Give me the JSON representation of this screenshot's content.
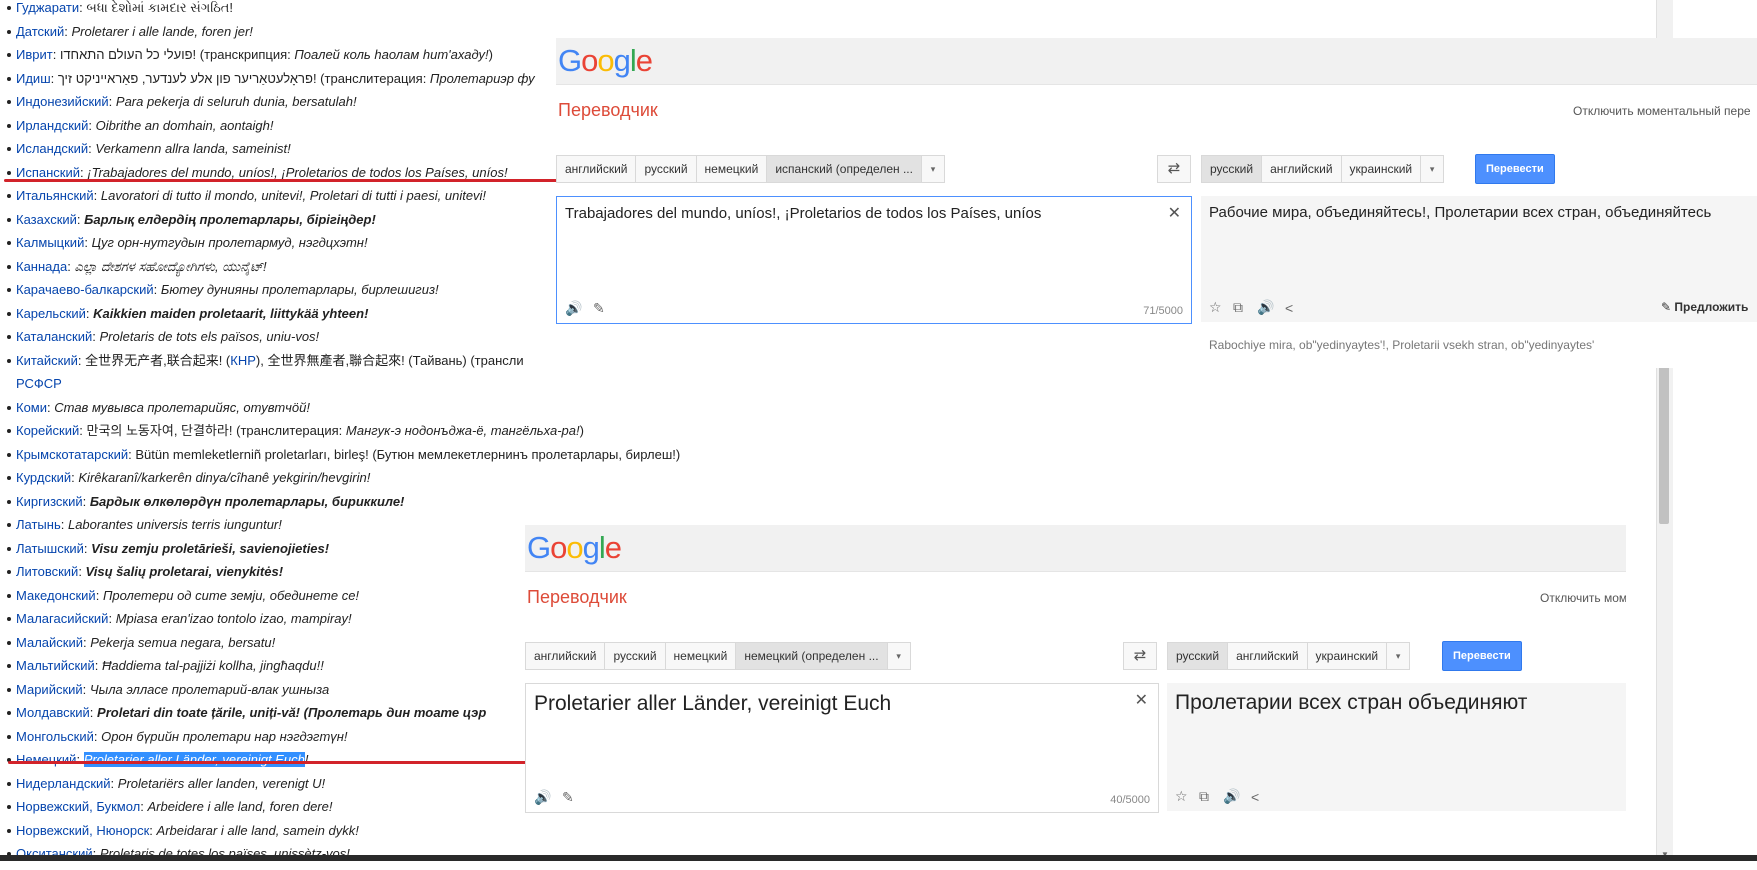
{
  "wiki_list": [
    {
      "lang": "Гуджарати",
      "sep": ": ",
      "phrase": "બધા દેશોમાં કામદાર સંગઠિત!",
      "style": "plain"
    },
    {
      "lang": "Датский",
      "sep": ": ",
      "phrase": "Proletarer i alle lande, foren jer!",
      "style": "italic"
    },
    {
      "lang": "Иврит",
      "sep": ": ",
      "phrase": "פועלי כל העולם התאחדו!",
      "style": "plain",
      "extra": " (транскрипция: ",
      "extra_it": "Поалей коль haолам hит'ахаду!",
      "extra_end": ")"
    },
    {
      "lang": "Идиш",
      "sep": ": ",
      "phrase": "פראָלעטאַריער פון אלע לענדער, פאַראייניקט זיך!",
      "style": "plain",
      "extra": " (транслитерация: ",
      "extra_it": "Пролетариэр фу",
      "extra_end": ""
    },
    {
      "lang": "Индонезийский",
      "sep": ": ",
      "phrase": "Para pekerja di seluruh dunia, bersatulah!",
      "style": "italic"
    },
    {
      "lang": "Ирландский",
      "sep": ": ",
      "phrase": "Oibrithe an domhain, aontaigh!",
      "style": "italic"
    },
    {
      "lang": "Исландский",
      "sep": ": ",
      "phrase": "Verkamenn allra landa, sameinist!",
      "style": "italic"
    },
    {
      "lang": "Испанский",
      "sep": ": ",
      "phrase": "¡Trabajadores del mundo, uníos!, ¡Proletarios de todos los Países, uníos!",
      "style": "italic"
    },
    {
      "lang": "Итальянский",
      "sep": ": ",
      "phrase": "Lavoratori di tutto il mondo, unitevi!, Proletari di tutti i paesi, unitevi!",
      "style": "italic"
    },
    {
      "lang": "Казахский",
      "sep": ": ",
      "phrase": "Барлық елдердің пролетарлары, бірігіңдер!",
      "style": "bold"
    },
    {
      "lang": "Калмыцкий",
      "sep": ": ",
      "phrase": "Цуг орн-нутгудын пролетармуд, нэгдцхэтн!",
      "style": "italic"
    },
    {
      "lang": "Каннада",
      "sep": ": ",
      "phrase": "ಎಲ್ಲಾ ದೇಶಗಳ ಸಹೋದ್ಯೋಗಿಗಳು, ಯುನೈಟ್!",
      "style": "italic"
    },
    {
      "lang": "Карачаево-балкарский",
      "sep": ": ",
      "phrase": "Бютеу дунияны пролетарлары, бирлешигиз!",
      "style": "italic"
    },
    {
      "lang": "Карельский",
      "sep": ": ",
      "phrase": "Kaikkien maiden proletaarit, liittykää yhteen!",
      "style": "bold"
    },
    {
      "lang": "Каталанский",
      "sep": ": ",
      "phrase": "Proletaris de tots els països, uniu-vos!",
      "style": "italic"
    },
    {
      "lang": "Китайский",
      "sep": ": ",
      "phrase": "全世界无产者,联合起来! (",
      "style": "plain",
      "extra": "КНР",
      "extra_end": "), 全世界無產者,聯合起來! (Тайвань) (трансли"
    },
    {
      "lang": "",
      "sep": "",
      "phrase": "",
      "style": "plain",
      "extra": "РСФСР",
      "cont": true
    },
    {
      "lang": "Коми",
      "sep": ": ",
      "phrase": "Став мувывса пролетарийяс, отувтчöй!",
      "style": "italic"
    },
    {
      "lang": "Корейский",
      "sep": ": ",
      "phrase": "만국의 노동자여, 단결하라!",
      "style": "plain",
      "extra": " (транслитерация: ",
      "extra_it": "Мангук-э нодонъджа-ё, тангёльха-ра!",
      "extra_end": ")"
    },
    {
      "lang": "Крымскотатарский",
      "sep": ": ",
      "phrase": "Bütün memleketlerniñ proletarları, birleş! (Бутюн мемлекетлернинъ пролетарлары, бирлеш!)",
      "style": "plain"
    },
    {
      "lang": "Курдский",
      "sep": ": ",
      "phrase": "Kirêkaranî/karkerên dinya/cîhanê yekgirin/hevgirin!",
      "style": "italic"
    },
    {
      "lang": "Киргизский",
      "sep": ": ",
      "phrase": "Бардык өлкөлөрдүн пролетарлары, бириккиле!",
      "style": "bold"
    },
    {
      "lang": "Латынь",
      "sep": ": ",
      "phrase": "Laborantes universis terris iunguntur!",
      "style": "italic"
    },
    {
      "lang": "Латышский",
      "sep": ": ",
      "phrase": "Visu zemju proletārieši, savienojieties!",
      "style": "bold"
    },
    {
      "lang": "Литовский",
      "sep": ": ",
      "phrase": "Visų šalių proletarai, vienykitės!",
      "style": "bold"
    },
    {
      "lang": "Македонский",
      "sep": ": ",
      "phrase": "Пролетери од сите земји, обединете се!",
      "style": "italic"
    },
    {
      "lang": "Малагасийский",
      "sep": ": ",
      "phrase": "Mpiasa eran'izao tontolo izao, mampiray!",
      "style": "italic"
    },
    {
      "lang": "Малайский",
      "sep": ": ",
      "phrase": "Pekerja semua negara, bersatu!",
      "style": "italic"
    },
    {
      "lang": "Мальтийский",
      "sep": ": ",
      "phrase": "Ħaddiema tal-pajjiżi kollha, jingħaqdu!!",
      "style": "italic"
    },
    {
      "lang": "Марийский",
      "sep": ": ",
      "phrase": "Чыла элласе пролетарий-влак ушныза",
      "style": "italic"
    },
    {
      "lang": "Молдавский",
      "sep": ": ",
      "phrase": "Proletari din toate țările, uniți-vă! (Пролетарь дин тоате цэр",
      "style": "bold"
    },
    {
      "lang": "Монгольский",
      "sep": ": ",
      "phrase": "Орон бүрийн пролетари нар нэгдэгтүн!",
      "style": "italic"
    },
    {
      "lang": "Немецкий",
      "sep": ": ",
      "phrase": "Proletarier aller Länder, vereinigt Euch",
      "style": "highlight",
      "extra_end": "!"
    },
    {
      "lang": "Нидерландский",
      "sep": ": ",
      "phrase": "Proletariërs aller landen, verenigt U!",
      "style": "italic"
    },
    {
      "lang": "Норвежский, Букмол",
      "sep": ": ",
      "phrase": "Arbeidere i alle land, foren dere!",
      "style": "italic"
    },
    {
      "lang": "Норвежский, Нюнорск",
      "sep": ": ",
      "phrase": "Arbeidarar i alle land, samein dykk!",
      "style": "italic"
    },
    {
      "lang": "Окситанский",
      "sep": ": ",
      "phrase": "Proletaris de totes los païses, unissètz-vos!",
      "style": "italic"
    }
  ],
  "translator_top": {
    "logo": [
      "G",
      "o",
      "o",
      "g",
      "l",
      "e"
    ],
    "title": "Переводчик",
    "instant_off": "Отключить моментальный пере",
    "src_langs": [
      "английский",
      "русский",
      "немецкий",
      "испанский (определен ..."
    ],
    "tgt_langs": [
      "русский",
      "английский",
      "украинский"
    ],
    "translate": "Перевести",
    "source_text": "Trabajadores del mundo, uníos!, ¡Proletarios de todos los Países, uníos",
    "counter": "71/5000",
    "result": "Рабочие мира, объединяйтесь!, Пролетарии всех стран, объединяйтесь",
    "suggest": "Предложить",
    "translit": "Rabochiye mira, ob\"yedinyaytes'!, Proletarii vsekh stran, ob\"yedinyaytes'"
  },
  "translator_bottom": {
    "logo": [
      "G",
      "o",
      "o",
      "g",
      "l",
      "e"
    ],
    "title": "Переводчик",
    "instant_off": "Отключить мом",
    "src_langs": [
      "английский",
      "русский",
      "немецкий",
      "немецкий (определен ..."
    ],
    "tgt_langs": [
      "русский",
      "английский",
      "украинский"
    ],
    "translate": "Перевести",
    "source_text": "Proletarier aller Länder, vereinigt Euch",
    "counter": "40/5000",
    "result": "Пролетарии всех стран объединяют"
  },
  "icons": {
    "dropdown": "▾",
    "swap": "⇄",
    "clear": "✕",
    "speaker": "🔊",
    "pencil": "✎",
    "star": "☆",
    "copy": "⧉",
    "share": "<"
  }
}
